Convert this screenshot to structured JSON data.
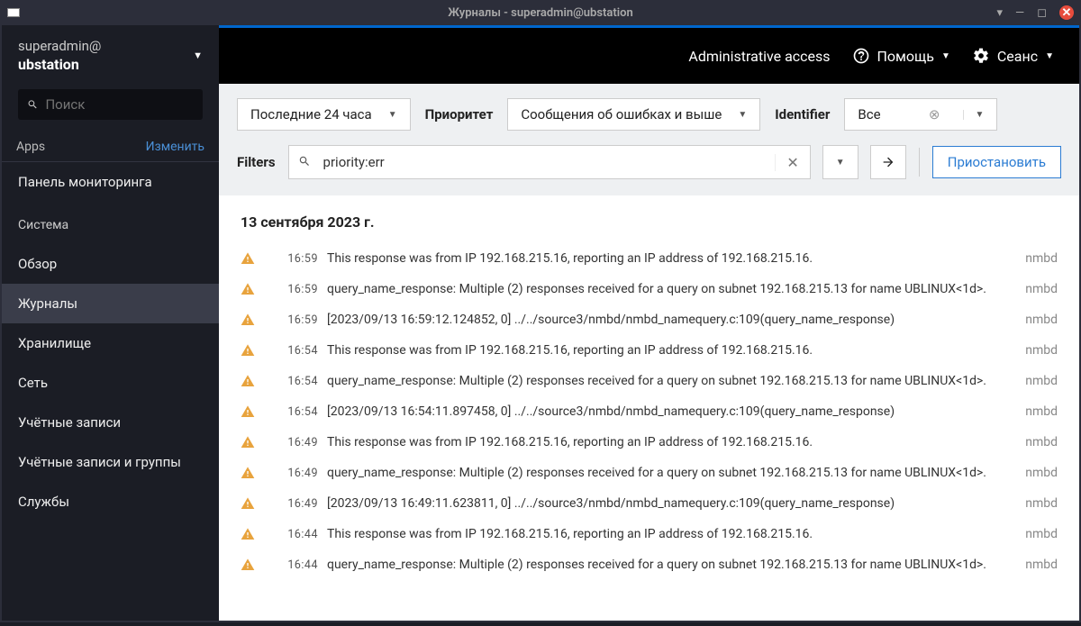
{
  "window": {
    "title": "Журналы - superadmin@ubstation"
  },
  "sidebar": {
    "user": "superadmin@",
    "host": "ubstation",
    "search_placeholder": "Поиск",
    "apps_label": "Apps",
    "edit_label": "Изменить",
    "items": [
      {
        "label": "Панель мониторинга",
        "section": false,
        "active": false
      },
      {
        "label": "Система",
        "section": true,
        "active": false
      },
      {
        "label": "Обзор",
        "section": false,
        "active": false
      },
      {
        "label": "Журналы",
        "section": false,
        "active": true
      },
      {
        "label": "Хранилище",
        "section": false,
        "active": false
      },
      {
        "label": "Сеть",
        "section": false,
        "active": false
      },
      {
        "label": "Учётные записи",
        "section": false,
        "active": false
      },
      {
        "label": "Учётные записи и группы",
        "section": false,
        "active": false
      },
      {
        "label": "Службы",
        "section": false,
        "active": false
      }
    ]
  },
  "topbar": {
    "admin": "Administrative access",
    "help": "Помощь",
    "session": "Сеанс"
  },
  "filters": {
    "time_range": "Последние 24 часа",
    "priority_label": "Приоритет",
    "priority_value": "Сообщения об ошибках и выше",
    "identifier_label": "Identifier",
    "identifier_value": "Все",
    "filters_label": "Filters",
    "search_value": "priority:err",
    "pause_label": "Приостановить"
  },
  "logs": {
    "date_header": "13 сентября 2023 г.",
    "entries": [
      {
        "time": "16:59",
        "msg": "This response was from IP 192.168.215.16, reporting an IP address of 192.168.215.16.",
        "src": "nmbd"
      },
      {
        "time": "16:59",
        "msg": "query_name_response: Multiple (2) responses received for a query on subnet 192.168.215.13 for name UBLINUX<1d>.",
        "src": "nmbd"
      },
      {
        "time": "16:59",
        "msg": "[2023/09/13 16:59:12.124852, 0] ../../source3/nmbd/nmbd_namequery.c:109(query_name_response)",
        "src": "nmbd"
      },
      {
        "time": "16:54",
        "msg": "This response was from IP 192.168.215.16, reporting an IP address of 192.168.215.16.",
        "src": "nmbd"
      },
      {
        "time": "16:54",
        "msg": "query_name_response: Multiple (2) responses received for a query on subnet 192.168.215.13 for name UBLINUX<1d>.",
        "src": "nmbd"
      },
      {
        "time": "16:54",
        "msg": "[2023/09/13 16:54:11.897458, 0] ../../source3/nmbd/nmbd_namequery.c:109(query_name_response)",
        "src": "nmbd"
      },
      {
        "time": "16:49",
        "msg": "This response was from IP 192.168.215.16, reporting an IP address of 192.168.215.16.",
        "src": "nmbd"
      },
      {
        "time": "16:49",
        "msg": "query_name_response: Multiple (2) responses received for a query on subnet 192.168.215.13 for name UBLINUX<1d>.",
        "src": "nmbd"
      },
      {
        "time": "16:49",
        "msg": "[2023/09/13 16:49:11.623811, 0] ../../source3/nmbd/nmbd_namequery.c:109(query_name_response)",
        "src": "nmbd"
      },
      {
        "time": "16:44",
        "msg": "This response was from IP 192.168.215.16, reporting an IP address of 192.168.215.16.",
        "src": "nmbd"
      },
      {
        "time": "16:44",
        "msg": "query_name_response: Multiple (2) responses received for a query on subnet 192.168.215.13 for name UBLINUX<1d>.",
        "src": "nmbd"
      }
    ]
  }
}
